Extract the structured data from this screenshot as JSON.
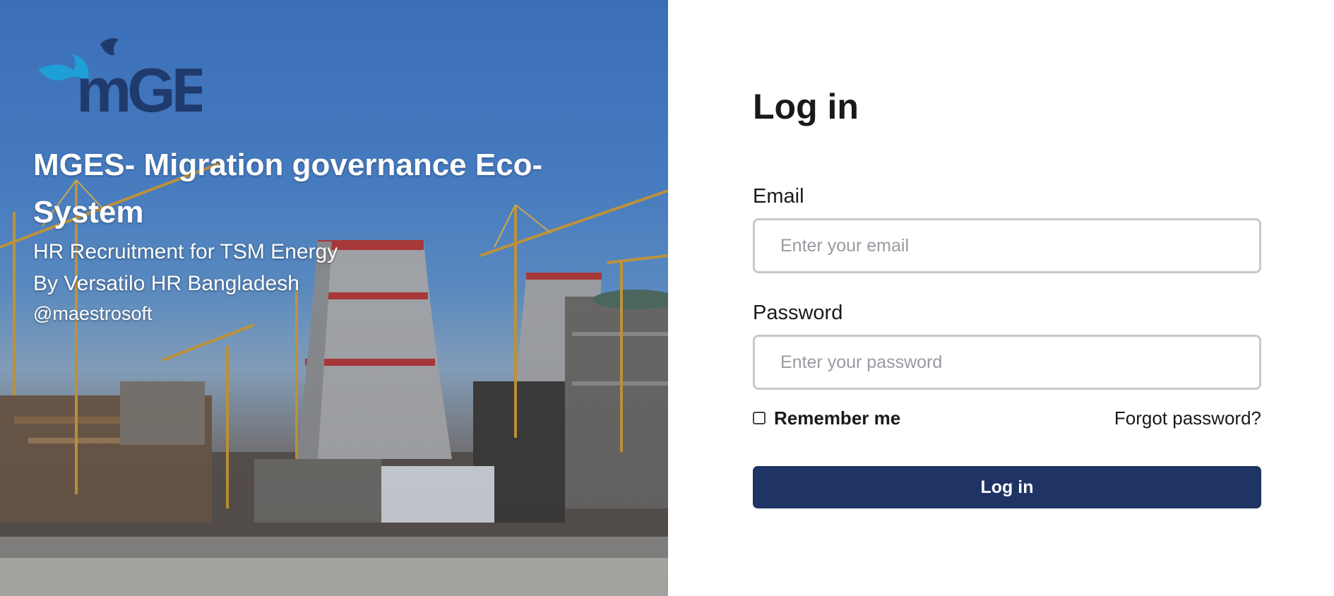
{
  "hero": {
    "logo_text": "mGES",
    "title": "MGES- Migration governance Eco-System",
    "subtitle_line1": "HR Recruitment for TSM Energy",
    "subtitle_line2": "By Versatilo HR Bangladesh",
    "handle": "@maestrosoft",
    "logo_color": "#1f3a6d",
    "logo_accent_color": "#1e9fd6"
  },
  "login": {
    "title": "Log in",
    "email_label": "Email",
    "email_placeholder": "Enter your email",
    "email_value": "",
    "password_label": "Password",
    "password_placeholder": "Enter your password",
    "password_value": "",
    "remember_label": "Remember me",
    "remember_checked": false,
    "forgot_label": "Forgot password?",
    "submit_label": "Log in",
    "button_color": "#1f3464"
  }
}
